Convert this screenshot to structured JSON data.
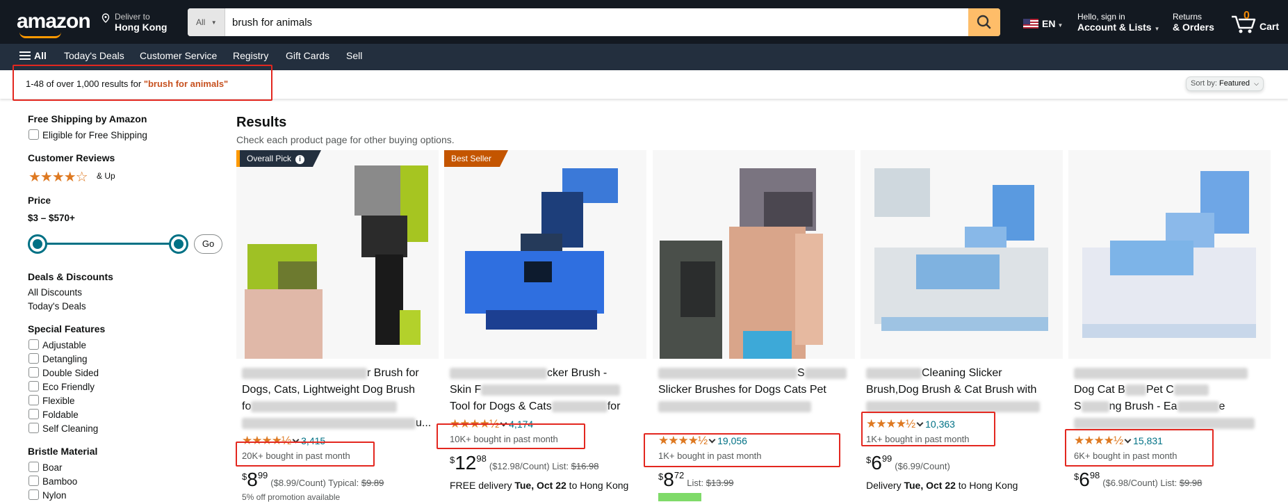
{
  "header": {
    "logo": "amazon",
    "deliver_label": "Deliver to",
    "deliver_location": "Hong Kong",
    "search_category": "All",
    "search_value": "brush for animals",
    "language": "EN",
    "account_greeting": "Hello, sign in",
    "account_label": "Account & Lists",
    "returns_label": "Returns",
    "orders_label": "& Orders",
    "cart_count": "0",
    "cart_label": "Cart"
  },
  "nav": {
    "all": "All",
    "items": [
      "Today's Deals",
      "Customer Service",
      "Registry",
      "Gift Cards",
      "Sell"
    ]
  },
  "results_bar": {
    "prefix": "1-48 of over 1,000 results for ",
    "query": "\"brush for animals\"",
    "sort_label": "Sort by:",
    "sort_value": "Featured"
  },
  "sidebar": {
    "shipping_title": "Free Shipping by Amazon",
    "shipping_option": "Eligible for Free Shipping",
    "reviews_title": "Customer Reviews",
    "reviews_stars": "★★★★☆",
    "reviews_andup": "& Up",
    "price_title": "Price",
    "price_range": "$3 – $570+",
    "price_go": "Go",
    "deals_title": "Deals & Discounts",
    "deals_items": [
      "All Discounts",
      "Today's Deals"
    ],
    "features_title": "Special Features",
    "features": [
      "Adjustable",
      "Detangling",
      "Double Sided",
      "Eco Friendly",
      "Flexible",
      "Foldable",
      "Self Cleaning"
    ],
    "bristle_title": "Bristle Material",
    "bristles": [
      "Boar",
      "Bamboo",
      "Nylon"
    ]
  },
  "main": {
    "title": "Results",
    "subtitle": "Check each product page for other buying options."
  },
  "products": [
    {
      "badge": "Overall Pick",
      "title_visible": [
        "r Brush for",
        "Dogs, Cats, Lightweight Dog Brush",
        "fo",
        "u..."
      ],
      "stars": "★★★★½",
      "review_count": "3,415",
      "bought": "20K+ bought in past month",
      "price_whole": "8",
      "price_frac": "99",
      "price_extra": "($8.99/Count) Typical: ",
      "price_list": "$9.89",
      "promo": "5% off promotion available"
    },
    {
      "badge": "Best Seller",
      "title_visible": [
        "cker Brush -",
        "Skin F",
        "Tool for Dogs & Cats",
        "for"
      ],
      "stars": "★★★★½",
      "review_count": "4,174",
      "bought": "10K+ bought in past month",
      "price_whole": "12",
      "price_frac": "98",
      "price_extra": "($12.98/Count) List: ",
      "price_list": "$16.98",
      "delivery_prefix": "FREE delivery ",
      "delivery_date": "Tue, Oct 22",
      "delivery_suffix": " to Hong Kong"
    },
    {
      "title_visible": [
        "S",
        "Slicker Brushes for Dogs Cats Pet"
      ],
      "stars": "★★★★½",
      "review_count": "19,056",
      "bought": "1K+ bought in past month",
      "price_whole": "8",
      "price_frac": "72",
      "price_extra": "List: ",
      "price_list": "$13.99"
    },
    {
      "title_visible": [
        "Cleaning Slicker",
        "Brush,Dog Brush & Cat Brush with"
      ],
      "stars": "★★★★½",
      "review_count": "10,363",
      "bought": "1K+ bought in past month",
      "price_whole": "6",
      "price_frac": "99",
      "price_extra": "($6.99/Count)",
      "delivery_prefix": "Delivery ",
      "delivery_date": "Tue, Oct 22",
      "delivery_suffix": " to Hong Kong"
    },
    {
      "title_visible": [
        "Dog Cat B",
        "Pet C",
        "S",
        "ng Brush - Ea",
        "e"
      ],
      "stars": "★★★★½",
      "review_count": "15,831",
      "bought": "6K+ bought in past month",
      "price_whole": "6",
      "price_frac": "98",
      "price_extra": "($6.98/Count) List: ",
      "price_list": "$9.98"
    }
  ],
  "colors": {
    "header_bg": "#131921",
    "nav_bg": "#232f3e",
    "accent": "#febd69",
    "star": "#de7921",
    "link": "#007185",
    "highlight": "#e3271f"
  }
}
